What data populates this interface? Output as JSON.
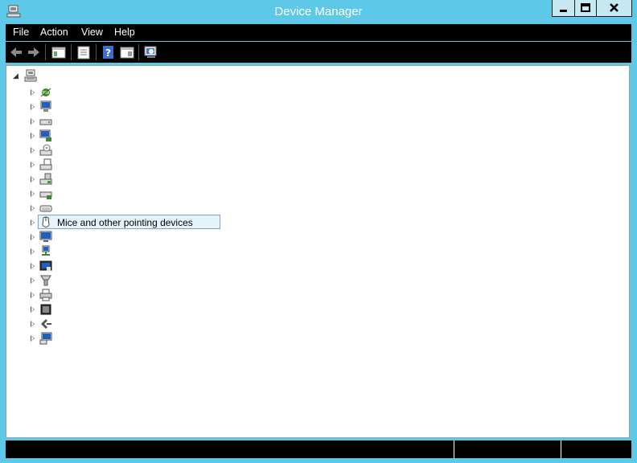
{
  "window": {
    "title": "Device Manager"
  },
  "menu": {
    "file": "File",
    "action": "Action",
    "view": "View",
    "help": "Help"
  },
  "toolbar": {
    "icons": [
      "back-icon",
      "forward-icon",
      "show-hide-console-tree-icon",
      "properties-icon",
      "help-icon",
      "show-action-pane-icon",
      "scan-hardware-icon"
    ]
  },
  "tree": {
    "root": {
      "icon": "computer-icon",
      "label": ""
    },
    "nodes": [
      {
        "icon": "audio-inputs-icon",
        "label": ""
      },
      {
        "icon": "computer-icon",
        "label": ""
      },
      {
        "icon": "disk-drive-icon",
        "label": ""
      },
      {
        "icon": "display-adapter-icon",
        "label": ""
      },
      {
        "icon": "dvd-drive-icon",
        "label": ""
      },
      {
        "icon": "floppy-controller-icon",
        "label": ""
      },
      {
        "icon": "floppy-drive-icon",
        "label": ""
      },
      {
        "icon": "ide-controller-icon",
        "label": ""
      },
      {
        "icon": "keyboard-icon",
        "label": ""
      },
      {
        "icon": "mouse-icon",
        "label": "Mice and other pointing devices",
        "selected": true
      },
      {
        "icon": "monitor-icon",
        "label": ""
      },
      {
        "icon": "network-adapter-icon",
        "label": ""
      },
      {
        "icon": "other-devices-icon",
        "label": ""
      },
      {
        "icon": "ports-icon",
        "label": ""
      },
      {
        "icon": "print-queue-icon",
        "label": ""
      },
      {
        "icon": "processor-icon",
        "label": ""
      },
      {
        "icon": "storage-controller-icon",
        "label": ""
      },
      {
        "icon": "system-devices-icon",
        "label": ""
      }
    ]
  },
  "colors": {
    "titlebar": "#5dc8e8",
    "bar": "#000000",
    "selection": "#e5f3fb"
  }
}
